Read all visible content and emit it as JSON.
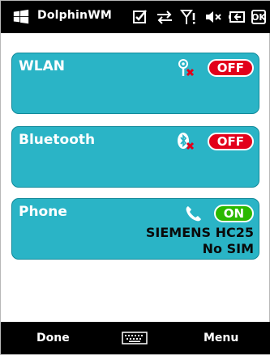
{
  "app": {
    "title": "DolphinWM"
  },
  "status": {
    "ok_label": "OK"
  },
  "cards": [
    {
      "title": "WLAN",
      "state": "OFF"
    },
    {
      "title": "Bluetooth",
      "state": "OFF"
    },
    {
      "title": "Phone",
      "state": "ON",
      "details": [
        "SIEMENS HC25",
        "No SIM"
      ]
    }
  ],
  "softkeys": {
    "left": "Done",
    "right": "Menu"
  },
  "colors": {
    "card": "#2ab4c6",
    "off": "#e2001a",
    "on": "#2bb800"
  },
  "icons": {
    "start": "windows-flag-icon",
    "status": [
      "notification-check-icon",
      "data-sync-icon",
      "signal-icon",
      "volume-muted-icon",
      "battery-icon"
    ],
    "wlan": "wifi-disabled-icon",
    "bluetooth": "bluetooth-disabled-icon",
    "phone": "phone-handset-icon",
    "softbar": "keyboard-icon"
  }
}
